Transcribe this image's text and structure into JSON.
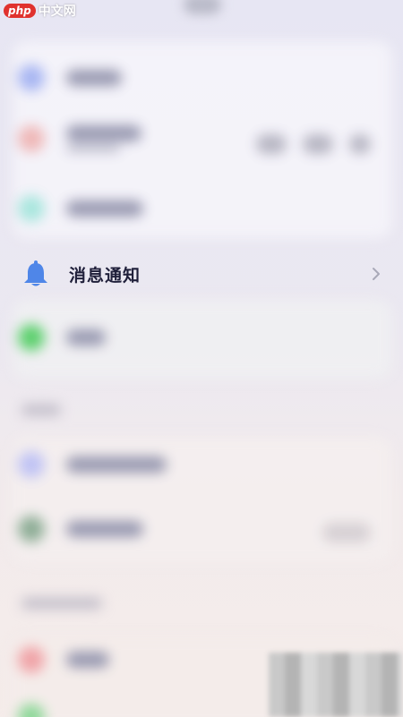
{
  "watermark": {
    "badge": "php",
    "text": "中文网"
  },
  "settings": {
    "notification_row": {
      "label": "消息通知",
      "icon": "bell-icon",
      "chevron": "chevron-right-icon"
    }
  },
  "colors": {
    "bell": "#4f86e8",
    "label": "#1f1f3a",
    "chevron": "#a9a9b8",
    "watermark_badge": "#e0322e"
  }
}
